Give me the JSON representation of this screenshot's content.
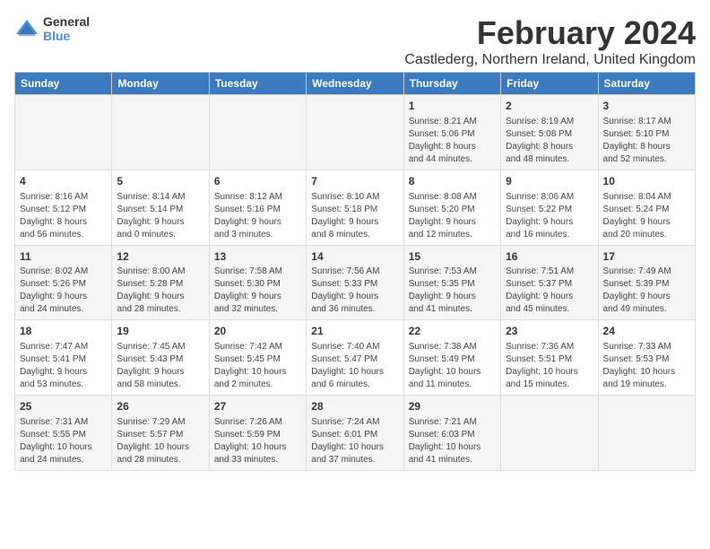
{
  "logo": {
    "line1": "General",
    "line2": "Blue"
  },
  "title": "February 2024",
  "subtitle": "Castlederg, Northern Ireland, United Kingdom",
  "days_header": [
    "Sunday",
    "Monday",
    "Tuesday",
    "Wednesday",
    "Thursday",
    "Friday",
    "Saturday"
  ],
  "weeks": [
    [
      {
        "day": "",
        "info": ""
      },
      {
        "day": "",
        "info": ""
      },
      {
        "day": "",
        "info": ""
      },
      {
        "day": "",
        "info": ""
      },
      {
        "day": "1",
        "info": "Sunrise: 8:21 AM\nSunset: 5:06 PM\nDaylight: 8 hours\nand 44 minutes."
      },
      {
        "day": "2",
        "info": "Sunrise: 8:19 AM\nSunset: 5:08 PM\nDaylight: 8 hours\nand 48 minutes."
      },
      {
        "day": "3",
        "info": "Sunrise: 8:17 AM\nSunset: 5:10 PM\nDaylight: 8 hours\nand 52 minutes."
      }
    ],
    [
      {
        "day": "4",
        "info": "Sunrise: 8:16 AM\nSunset: 5:12 PM\nDaylight: 8 hours\nand 56 minutes."
      },
      {
        "day": "5",
        "info": "Sunrise: 8:14 AM\nSunset: 5:14 PM\nDaylight: 9 hours\nand 0 minutes."
      },
      {
        "day": "6",
        "info": "Sunrise: 8:12 AM\nSunset: 5:16 PM\nDaylight: 9 hours\nand 3 minutes."
      },
      {
        "day": "7",
        "info": "Sunrise: 8:10 AM\nSunset: 5:18 PM\nDaylight: 9 hours\nand 8 minutes."
      },
      {
        "day": "8",
        "info": "Sunrise: 8:08 AM\nSunset: 5:20 PM\nDaylight: 9 hours\nand 12 minutes."
      },
      {
        "day": "9",
        "info": "Sunrise: 8:06 AM\nSunset: 5:22 PM\nDaylight: 9 hours\nand 16 minutes."
      },
      {
        "day": "10",
        "info": "Sunrise: 8:04 AM\nSunset: 5:24 PM\nDaylight: 9 hours\nand 20 minutes."
      }
    ],
    [
      {
        "day": "11",
        "info": "Sunrise: 8:02 AM\nSunset: 5:26 PM\nDaylight: 9 hours\nand 24 minutes."
      },
      {
        "day": "12",
        "info": "Sunrise: 8:00 AM\nSunset: 5:28 PM\nDaylight: 9 hours\nand 28 minutes."
      },
      {
        "day": "13",
        "info": "Sunrise: 7:58 AM\nSunset: 5:30 PM\nDaylight: 9 hours\nand 32 minutes."
      },
      {
        "day": "14",
        "info": "Sunrise: 7:56 AM\nSunset: 5:33 PM\nDaylight: 9 hours\nand 36 minutes."
      },
      {
        "day": "15",
        "info": "Sunrise: 7:53 AM\nSunset: 5:35 PM\nDaylight: 9 hours\nand 41 minutes."
      },
      {
        "day": "16",
        "info": "Sunrise: 7:51 AM\nSunset: 5:37 PM\nDaylight: 9 hours\nand 45 minutes."
      },
      {
        "day": "17",
        "info": "Sunrise: 7:49 AM\nSunset: 5:39 PM\nDaylight: 9 hours\nand 49 minutes."
      }
    ],
    [
      {
        "day": "18",
        "info": "Sunrise: 7:47 AM\nSunset: 5:41 PM\nDaylight: 9 hours\nand 53 minutes."
      },
      {
        "day": "19",
        "info": "Sunrise: 7:45 AM\nSunset: 5:43 PM\nDaylight: 9 hours\nand 58 minutes."
      },
      {
        "day": "20",
        "info": "Sunrise: 7:42 AM\nSunset: 5:45 PM\nDaylight: 10 hours\nand 2 minutes."
      },
      {
        "day": "21",
        "info": "Sunrise: 7:40 AM\nSunset: 5:47 PM\nDaylight: 10 hours\nand 6 minutes."
      },
      {
        "day": "22",
        "info": "Sunrise: 7:38 AM\nSunset: 5:49 PM\nDaylight: 10 hours\nand 11 minutes."
      },
      {
        "day": "23",
        "info": "Sunrise: 7:36 AM\nSunset: 5:51 PM\nDaylight: 10 hours\nand 15 minutes."
      },
      {
        "day": "24",
        "info": "Sunrise: 7:33 AM\nSunset: 5:53 PM\nDaylight: 10 hours\nand 19 minutes."
      }
    ],
    [
      {
        "day": "25",
        "info": "Sunrise: 7:31 AM\nSunset: 5:55 PM\nDaylight: 10 hours\nand 24 minutes."
      },
      {
        "day": "26",
        "info": "Sunrise: 7:29 AM\nSunset: 5:57 PM\nDaylight: 10 hours\nand 28 minutes."
      },
      {
        "day": "27",
        "info": "Sunrise: 7:26 AM\nSunset: 5:59 PM\nDaylight: 10 hours\nand 33 minutes."
      },
      {
        "day": "28",
        "info": "Sunrise: 7:24 AM\nSunset: 6:01 PM\nDaylight: 10 hours\nand 37 minutes."
      },
      {
        "day": "29",
        "info": "Sunrise: 7:21 AM\nSunset: 6:03 PM\nDaylight: 10 hours\nand 41 minutes."
      },
      {
        "day": "",
        "info": ""
      },
      {
        "day": "",
        "info": ""
      }
    ]
  ]
}
